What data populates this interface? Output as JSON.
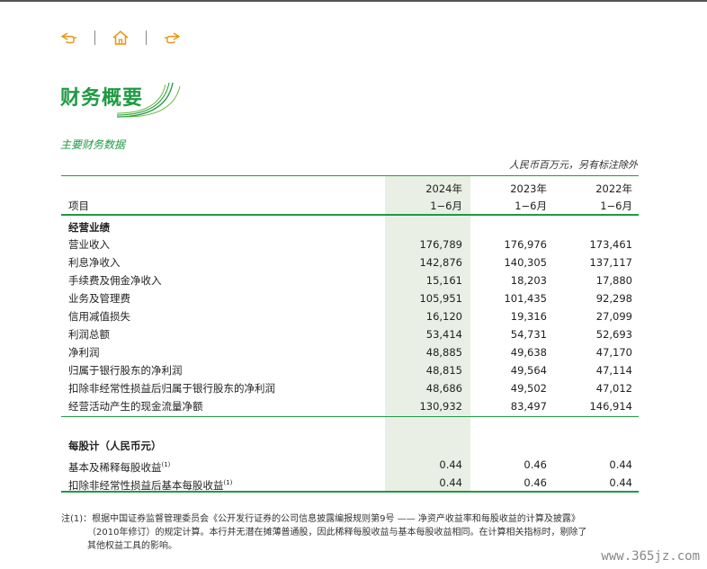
{
  "nav": {
    "prev_icon": "hand-left-icon",
    "home_icon": "home-icon",
    "next_icon": "hand-right-icon"
  },
  "page": {
    "title": "财务概要",
    "subtitle": "主要财务数据",
    "unit_note": "人民币百万元，另有标注除外"
  },
  "table": {
    "header": {
      "item": "项目",
      "cols": [
        {
          "year": "2024年",
          "period": "1−6月"
        },
        {
          "year": "2023年",
          "period": "1−6月"
        },
        {
          "year": "2022年",
          "period": "1−6月"
        }
      ]
    },
    "section1_title": "经营业绩",
    "rows1": [
      {
        "label": "营业收入",
        "v": [
          "176,789",
          "176,976",
          "173,461"
        ]
      },
      {
        "label": "利息净收入",
        "v": [
          "142,876",
          "140,305",
          "137,117"
        ]
      },
      {
        "label": "手续费及佣金净收入",
        "v": [
          "15,161",
          "18,203",
          "17,880"
        ]
      },
      {
        "label": "业务及管理费",
        "v": [
          "105,951",
          "101,435",
          "92,298"
        ]
      },
      {
        "label": "信用减值损失",
        "v": [
          "16,120",
          "19,316",
          "27,099"
        ]
      },
      {
        "label": "利润总额",
        "v": [
          "53,414",
          "54,731",
          "52,693"
        ]
      },
      {
        "label": "净利润",
        "v": [
          "48,885",
          "49,638",
          "47,170"
        ]
      },
      {
        "label": "归属于银行股东的净利润",
        "v": [
          "48,815",
          "49,564",
          "47,114"
        ]
      },
      {
        "label": "扣除非经常性损益后归属于银行股东的净利润",
        "v": [
          "48,686",
          "49,502",
          "47,012"
        ]
      },
      {
        "label": "经营活动产生的现金流量净额",
        "v": [
          "130,932",
          "83,497",
          "146,914"
        ]
      }
    ],
    "section2_title": "每股计（人民币元）",
    "rows2": [
      {
        "label": "基本及稀释每股收益",
        "sup": "(1)",
        "v": [
          "0.44",
          "0.46",
          "0.44"
        ]
      },
      {
        "label": "扣除非经常性损益后基本每股收益",
        "sup": "(1)",
        "v": [
          "0.44",
          "0.46",
          "0.44"
        ]
      }
    ]
  },
  "footnote": {
    "line1": "注(1)：根据中国证券监督管理委员会《公开发行证券的公司信息披露编报规则第9号 —— 净资产收益率和每股收益的计算及披露》",
    "line2": "（2010年修订）的规定计算。本行并无潜在摊薄普通股，因此稀释每股收益与基本每股收益相同。在计算相关指标时，剔除了",
    "line3": "其他权益工具的影响。"
  },
  "watermark": "www.365jz.com",
  "colors": {
    "accent": "#1f9a43",
    "nav_icon": "#e89414",
    "highlight": "#e9efe4"
  }
}
